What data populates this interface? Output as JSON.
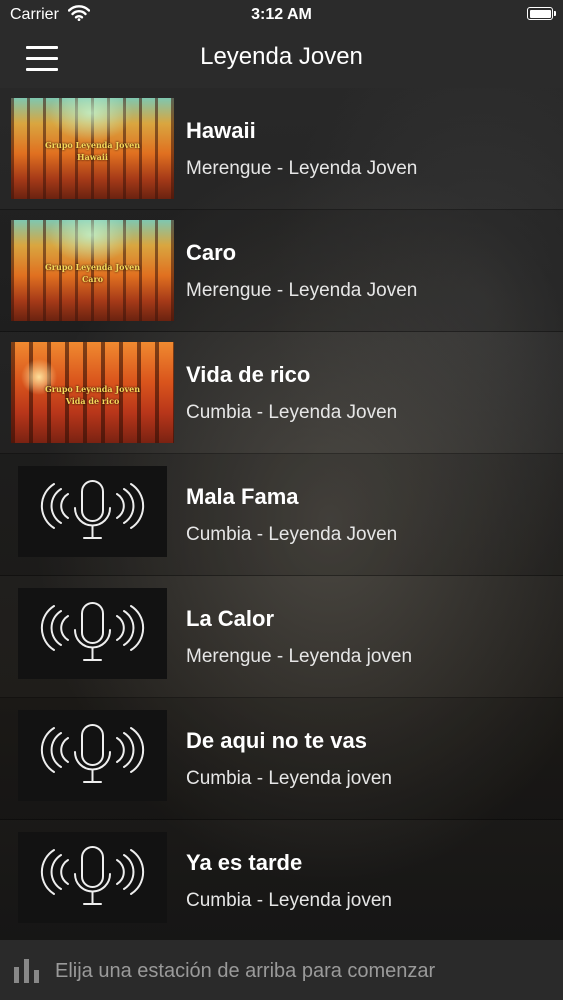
{
  "status_bar": {
    "carrier": "Carrier",
    "time": "3:12 AM",
    "icons": [
      "wifi-icon",
      "battery-icon"
    ]
  },
  "nav": {
    "title": "Leyenda Joven",
    "menu_icon": "hamburger-menu-icon"
  },
  "tracks": [
    {
      "title": "Hawaii",
      "subtitle": "Merengue - Leyenda Joven",
      "thumb": "forest-artwork",
      "caption_top": "Grupo Leyenda Joven",
      "caption_song": "Hawaii"
    },
    {
      "title": "Caro",
      "subtitle": "Merengue - Leyenda Joven",
      "thumb": "forest-artwork",
      "caption_top": "Grupo Leyenda Joven",
      "caption_song": "Caro"
    },
    {
      "title": "Vida de rico",
      "subtitle": "Cumbia - Leyenda Joven",
      "thumb": "forest-artwork",
      "caption_top": "Grupo Leyenda Joven",
      "caption_song": "Vida de rico"
    },
    {
      "title": "Mala Fama",
      "subtitle": "Cumbia - Leyenda Joven",
      "thumb": "microphone-icon"
    },
    {
      "title": "La Calor",
      "subtitle": "Merengue - Leyenda joven",
      "thumb": "microphone-icon"
    },
    {
      "title": "De aqui no te vas",
      "subtitle": "Cumbia - Leyenda joven",
      "thumb": "microphone-icon"
    },
    {
      "title": "Ya es tarde",
      "subtitle": "Cumbia - Leyenda joven",
      "thumb": "microphone-icon"
    }
  ],
  "footer": {
    "icon": "equalizer-bars-icon",
    "text": "Elija una estación de arriba para comenzar"
  },
  "colors": {
    "bar_background": "#2b2b2b",
    "footer_text": "#9a9a9a",
    "caption": "#f5d85a"
  }
}
